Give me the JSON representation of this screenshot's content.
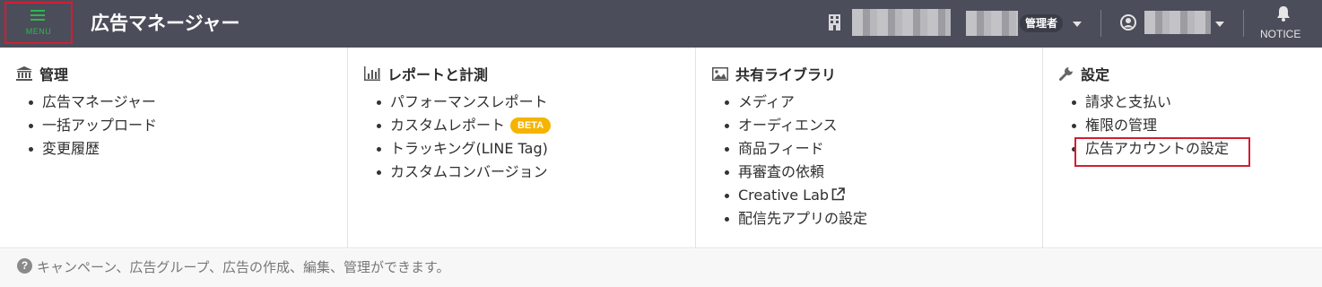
{
  "header": {
    "menu_label": "MENU",
    "app_title": "広告マネージャー",
    "role_badge": "管理者",
    "notice_label": "NOTICE"
  },
  "columns": [
    {
      "title": "管理",
      "icon": "bank-icon",
      "items": [
        "広告マネージャー",
        "一括アップロード",
        "変更履歴"
      ]
    },
    {
      "title": "レポートと計測",
      "icon": "bar-chart-icon",
      "items": [
        "パフォーマンスレポート",
        "カスタムレポート",
        "トラッキング(LINE Tag)",
        "カスタムコンバージョン"
      ],
      "beta_label": "BETA"
    },
    {
      "title": "共有ライブラリ",
      "icon": "image-icon",
      "items": [
        "メディア",
        "オーディエンス",
        "商品フィード",
        "再審査の依頼",
        "Creative Lab",
        "配信先アプリの設定"
      ]
    },
    {
      "title": "設定",
      "icon": "wrench-icon",
      "items": [
        "請求と支払い",
        "権限の管理",
        "広告アカウントの設定"
      ]
    }
  ],
  "footer": {
    "text": "キャンペーン、広告グループ、広告の作成、編集、管理ができます。"
  },
  "colors": {
    "header_bg": "#4b4d5a",
    "accent_green": "#2db84c",
    "highlight_red": "#d31d32",
    "beta_yellow": "#f4b400"
  }
}
